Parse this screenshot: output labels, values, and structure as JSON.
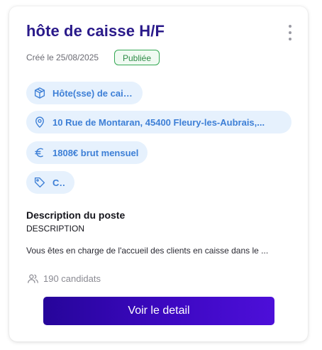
{
  "job": {
    "title": "hôte de caisse H/F",
    "created": "Créé le 25/08/2025",
    "status": "Publiée"
  },
  "chips": {
    "role": "Hôte(sse) de caisse",
    "address": "10 Rue de Montaran, 45400 Fleury-les-Aubrais,...",
    "salary": "1808€ brut mensuel",
    "contract": "CDI"
  },
  "description": {
    "heading": "Description du poste",
    "subheading": "DESCRIPTION",
    "text": "Vous êtes en charge de l'accueil des clients en caisse dans le ..."
  },
  "candidates": {
    "label": "190 candidats"
  },
  "actions": {
    "detail_label": "Voir le detail"
  },
  "icons": {
    "menu": "more-vertical-icon",
    "role": "box-icon",
    "address": "map-pin-icon",
    "salary": "euro-icon",
    "contract": "tag-icon",
    "candidates": "users-icon"
  },
  "colors": {
    "title": "#2a1a8a",
    "chip_bg": "#e6f1fd",
    "chip_text": "#3d7fd6",
    "status_border": "#34a853",
    "status_text": "#2e8b47",
    "button_start": "#26059a",
    "button_end": "#4d0fd9"
  }
}
